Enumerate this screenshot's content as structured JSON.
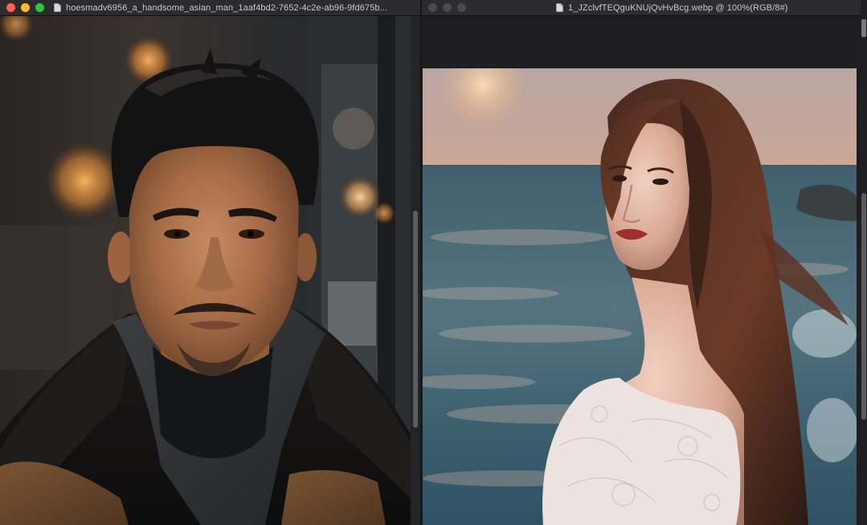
{
  "windows": {
    "left": {
      "title": "hoesmadv6956_a_handsome_asian_man_1aaf4bd2-7652-4c2e-ab96-9fd675b..."
    },
    "right": {
      "title": "1_JZclvfTEQguKNUjQvHvBcg.webp @ 100%(RGB/8#)"
    }
  },
  "colors": {
    "titlebar": "#2c2c2e",
    "close": "#ff5f57",
    "minimize": "#febc2e",
    "zoom": "#28c840",
    "inactive_button": "#4a4a4d"
  },
  "icons": {
    "document": "document-icon"
  }
}
